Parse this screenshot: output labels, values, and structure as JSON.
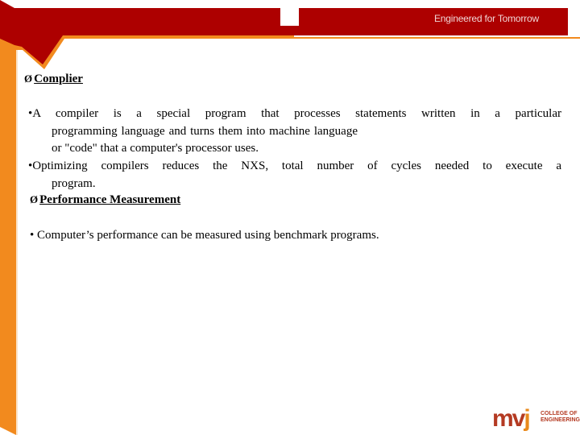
{
  "header": {
    "tagline": "Engineered for Tomorrow",
    "colors": {
      "banner": "#ad0000",
      "accent": "#f28a1e"
    }
  },
  "sections": [
    {
      "bullet": "Ø",
      "title": " Complier",
      "paragraphs": [
        {
          "bullet": "•",
          "first_line": "A compiler is a special program that processes statements written in a particular",
          "rest": "programming language and turns them into machine language or \"code\" that a computer's processor uses."
        },
        {
          "bullet": "•",
          "first_line": "Optimizing compilers reduces the NXS, total number of cycles needed to execute a",
          "rest": "program."
        }
      ]
    },
    {
      "bullet": "Ø",
      "title": " Performance Measurement",
      "paragraphs": [
        {
          "bullet": "•",
          "text": " Computer’s performance can be measured using benchmark programs."
        }
      ]
    }
  ],
  "logo": {
    "mark_mv": "mv",
    "mark_j": "j",
    "line1": "COLLEGE OF",
    "line2": "ENGINEERING"
  }
}
